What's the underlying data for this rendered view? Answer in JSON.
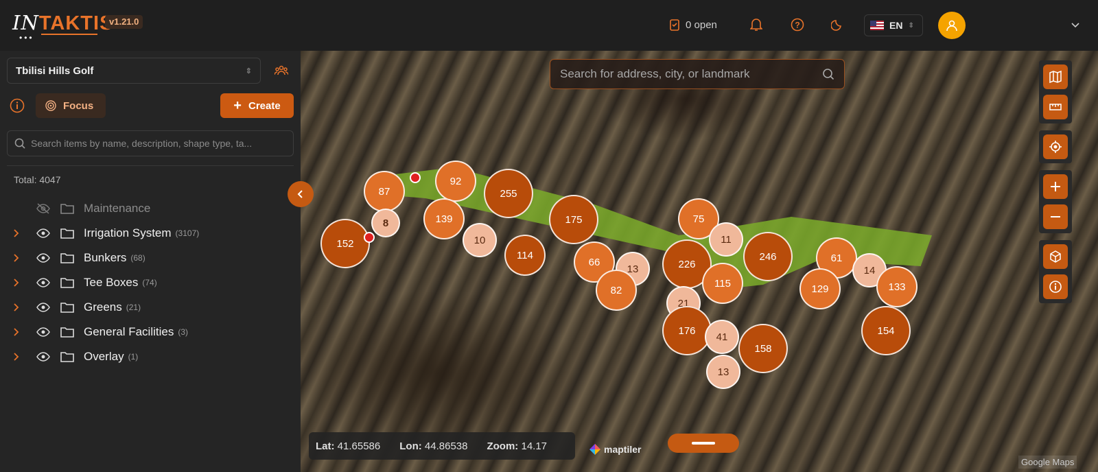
{
  "app": {
    "logo_in": "IN",
    "logo_taktis": "TAKTIS",
    "version": "v1.21.0"
  },
  "header": {
    "open_count": "0 open",
    "language": "EN"
  },
  "sidebar": {
    "project": "Tbilisi Hills Golf",
    "focus_label": "Focus",
    "create_label": "Create",
    "search_placeholder": "Search items by name, description, shape type, ta...",
    "total": "Total: 4047",
    "items": [
      {
        "label": "Maintenance",
        "count": "",
        "visible": false
      },
      {
        "label": "Irrigation System",
        "count": "(3107)",
        "visible": true
      },
      {
        "label": "Bunkers",
        "count": "(68)",
        "visible": true
      },
      {
        "label": "Tee Boxes",
        "count": "(74)",
        "visible": true
      },
      {
        "label": "Greens",
        "count": "(21)",
        "visible": true
      },
      {
        "label": "General Facilities",
        "count": "(3)",
        "visible": true
      },
      {
        "label": "Overlay",
        "count": "(1)",
        "visible": true
      }
    ]
  },
  "map": {
    "search_placeholder": "Search for address, city, or landmark",
    "lat_label": "Lat:",
    "lat": "41.65586",
    "lon_label": "Lon:",
    "lon": "44.86538",
    "zoom_label": "Zoom:",
    "zoom": "14.17",
    "maptiler": "maptiler",
    "attribution": "Google Maps",
    "clusters": [
      "87",
      "92",
      "255",
      "139",
      "8",
      "152",
      "10",
      "114",
      "175",
      "66",
      "13",
      "82",
      "75",
      "11",
      "226",
      "115",
      "246",
      "61",
      "14",
      "129",
      "133",
      "21",
      "176",
      "41",
      "158",
      "13",
      "154"
    ]
  },
  "colors": {
    "accent": "#cc5a12",
    "avatar": "#f5a300"
  }
}
